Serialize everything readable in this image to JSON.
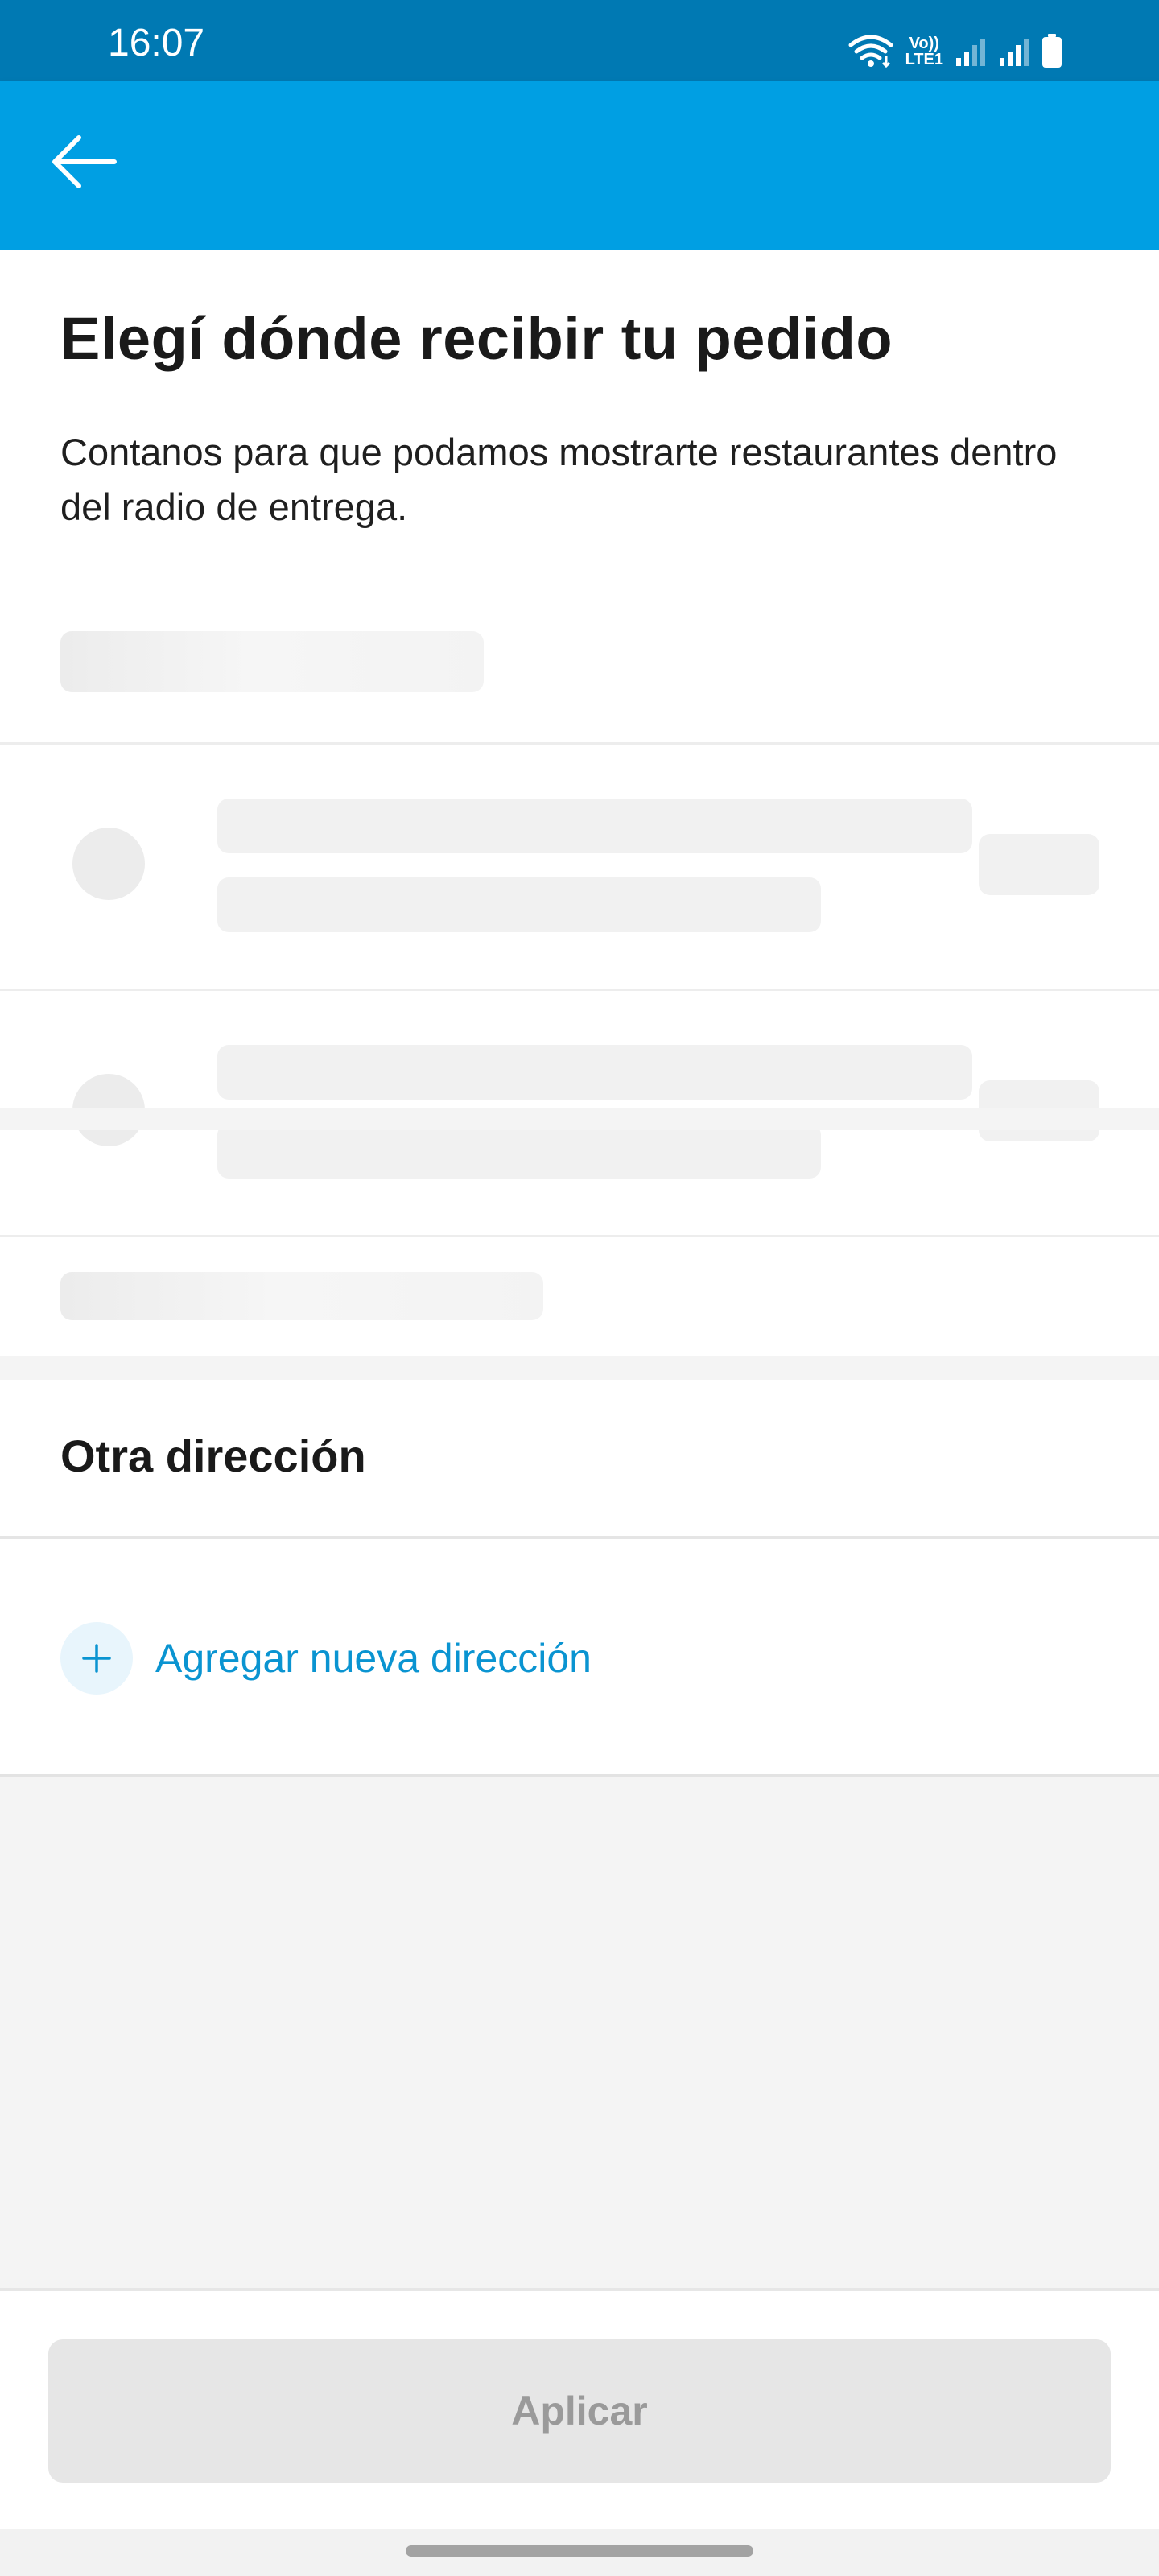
{
  "status_bar": {
    "time": "16:07",
    "network_label_top": "Vo))",
    "network_label_bottom": "LTE1",
    "icons": [
      "wifi-icon",
      "signal-icon",
      "signal-icon",
      "battery-icon"
    ]
  },
  "app_bar": {
    "back_icon": "arrow-left-icon",
    "color": "#009fe3"
  },
  "page": {
    "title": "Elegí dónde recibir tu pedido",
    "subtitle": "Contanos para que podamos mostrarte restaurantes dentro del radio de entrega."
  },
  "other_address": {
    "title": "Otra dirección",
    "add_label": "Agregar nueva dirección",
    "add_icon": "plus-icon",
    "accent_color": "#0a94d1"
  },
  "footer": {
    "apply_label": "Aplicar"
  }
}
